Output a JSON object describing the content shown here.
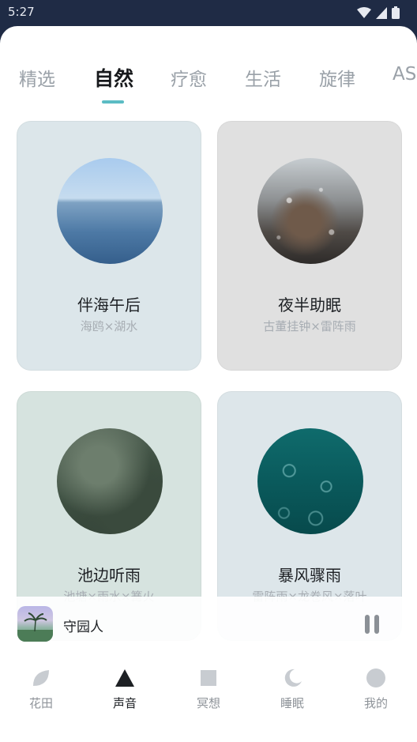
{
  "status_bar": {
    "time": "5:27"
  },
  "tabs": [
    {
      "label": "精选",
      "active": false
    },
    {
      "label": "自然",
      "active": true
    },
    {
      "label": "疗愈",
      "active": false
    },
    {
      "label": "生活",
      "active": false
    },
    {
      "label": "旋律",
      "active": false
    },
    {
      "label": "AS",
      "active": false
    }
  ],
  "cards": [
    {
      "title": "伴海午后",
      "subtitle": "海鸥×湖水",
      "art": "sea-horizon-image",
      "bg": "#dce6ea"
    },
    {
      "title": "夜半助眠",
      "subtitle": "古董挂钟×雷阵雨",
      "art": "rainy-window-image",
      "bg": "#e0e0e0"
    },
    {
      "title": "池边听雨",
      "subtitle": "池塘×雨水×篝火",
      "art": "pond-greenery-image",
      "bg": "#d6e3df"
    },
    {
      "title": "暴风骤雨",
      "subtitle": "雷阵雨×龙卷风×落叶",
      "art": "storm-ripples-image",
      "bg": "#dde6ea"
    }
  ],
  "mini_player": {
    "title": "守园人",
    "cover": "garden-cover-image",
    "state": "playing"
  },
  "bottom_nav": [
    {
      "label": "花田",
      "icon": "leaf-icon",
      "active": false
    },
    {
      "label": "声音",
      "icon": "triangle-icon",
      "active": true
    },
    {
      "label": "冥想",
      "icon": "square-icon",
      "active": false
    },
    {
      "label": "睡眠",
      "icon": "moon-icon",
      "active": false
    },
    {
      "label": "我的",
      "icon": "circle-icon",
      "active": false
    }
  ],
  "colors": {
    "accent": "#5bbcc4",
    "status_bar_bg": "#1f2b45",
    "nav_inactive": "#8e9399",
    "nav_active": "#1d2024"
  }
}
